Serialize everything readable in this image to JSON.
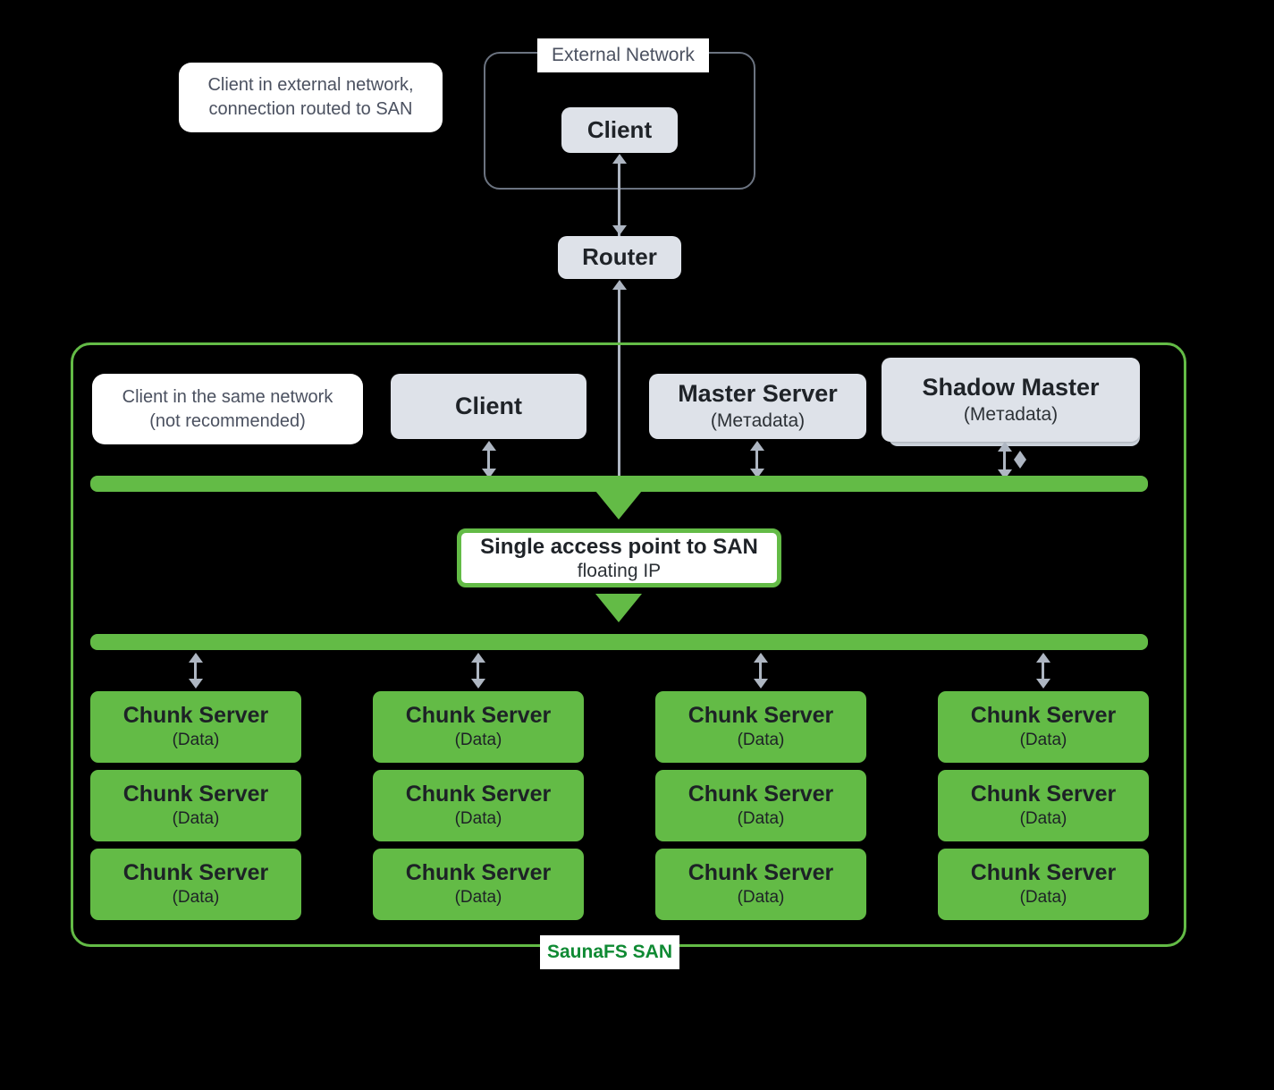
{
  "diagram": {
    "title": "SaunaFS SAN architecture",
    "colors": {
      "green": "#63bb46",
      "green_text": "#0f8a33",
      "grey_node": "#dee2e9",
      "connector": "#aeb6c2",
      "background": "#000000",
      "callout_text": "#4b5160"
    }
  },
  "callouts": {
    "external_client": "Client in external network,\nconnection routed to SAN",
    "internal_client": "Client in the same network\n(not recommended)"
  },
  "external_network": {
    "label": "External Network",
    "client": {
      "title": "Client"
    }
  },
  "router": {
    "title": "Router"
  },
  "san": {
    "label": "SaunaFS SAN",
    "top_row": [
      {
        "title": "Client",
        "sub": ""
      },
      {
        "title": "Master Server",
        "sub": "(Meтadata)"
      },
      {
        "title": "Shadow Master",
        "sub": "(Meтadata)"
      }
    ],
    "access_point": {
      "title": "Single access point to SAN",
      "sub": "floating IP"
    },
    "chunk_servers": [
      [
        {
          "title": "Chunk Server",
          "sub": "(Data)"
        },
        {
          "title": "Chunk Server",
          "sub": "(Data)"
        },
        {
          "title": "Chunk Server",
          "sub": "(Data)"
        },
        {
          "title": "Chunk Server",
          "sub": "(Data)"
        }
      ],
      [
        {
          "title": "Chunk Server",
          "sub": "(Data)"
        },
        {
          "title": "Chunk Server",
          "sub": "(Data)"
        },
        {
          "title": "Chunk Server",
          "sub": "(Data)"
        },
        {
          "title": "Chunk Server",
          "sub": "(Data)"
        }
      ],
      [
        {
          "title": "Chunk Server",
          "sub": "(Data)"
        },
        {
          "title": "Chunk Server",
          "sub": "(Data)"
        },
        {
          "title": "Chunk Server",
          "sub": "(Data)"
        },
        {
          "title": "Chunk Server",
          "sub": "(Data)"
        }
      ]
    ]
  }
}
